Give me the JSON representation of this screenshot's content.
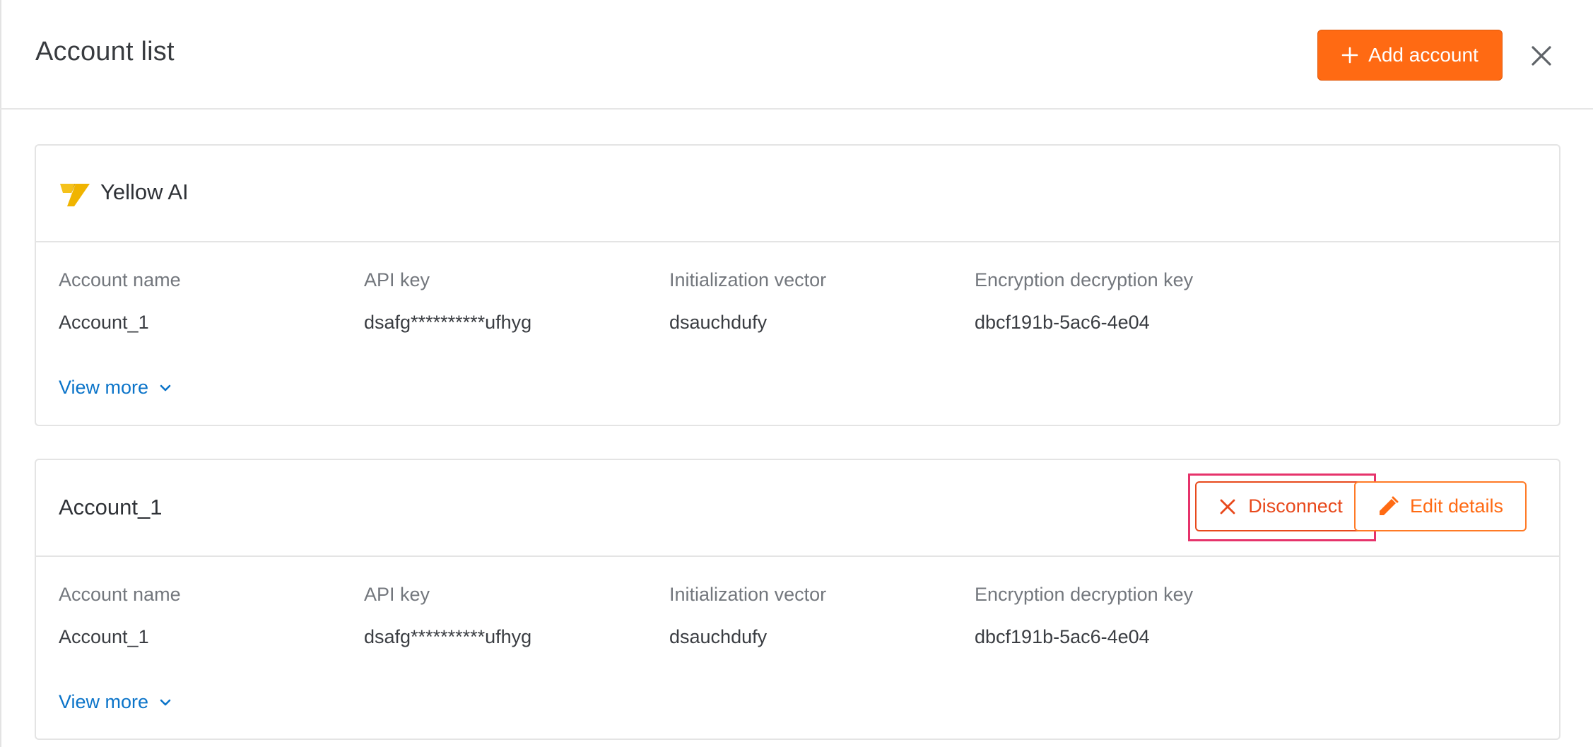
{
  "header": {
    "title": "Account list",
    "add_button_label": "Add account"
  },
  "colors": {
    "accent": "#ff6a13",
    "danger": "#e8491c",
    "link": "#0b74c9",
    "focus_ring": "#e6336b"
  },
  "cards": [
    {
      "title": "Yellow AI",
      "logo_icon": "yellow-ai-logo",
      "fields": [
        {
          "label": "Account name",
          "value": "Account_1"
        },
        {
          "label": "API key",
          "value": "dsafg**********ufhyg"
        },
        {
          "label": "Initialization vector",
          "value": "dsauchdufy"
        },
        {
          "label": "Encryption decryption key",
          "value": "dbcf191b-5ac6-4e04"
        }
      ],
      "view_more_label": "View more"
    },
    {
      "title": "Account_1",
      "disconnect_label": "Disconnect",
      "edit_label": "Edit details",
      "fields": [
        {
          "label": "Account name",
          "value": "Account_1"
        },
        {
          "label": "API key",
          "value": "dsafg**********ufhyg"
        },
        {
          "label": "Initialization vector",
          "value": "dsauchdufy"
        },
        {
          "label": "Encryption decryption key",
          "value": "dbcf191b-5ac6-4e04"
        }
      ],
      "view_more_label": "View more"
    }
  ]
}
